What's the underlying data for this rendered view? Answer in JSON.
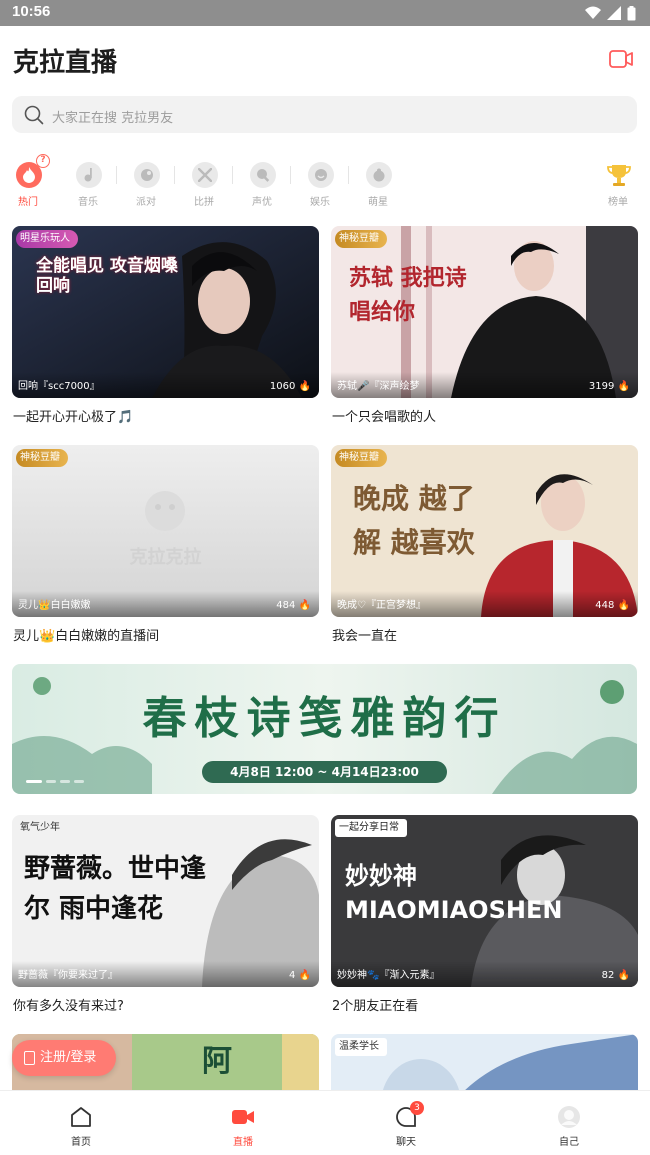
{
  "status_bar": {
    "time": "10:56"
  },
  "header": {
    "title": "克拉直播",
    "camera_icon": "video-camera-icon"
  },
  "search": {
    "placeholder": "大家正在搜 克拉男友"
  },
  "categories": [
    {
      "label": "热门",
      "icon": "flame-icon",
      "active": true,
      "badge": "?"
    },
    {
      "label": "音乐",
      "icon": "music-icon"
    },
    {
      "label": "派对",
      "icon": "party-icon"
    },
    {
      "label": "比拼",
      "icon": "pk-icon"
    },
    {
      "label": "声优",
      "icon": "voice-actor-icon"
    },
    {
      "label": "娱乐",
      "icon": "entertainment-icon"
    },
    {
      "label": "萌星",
      "icon": "cute-star-icon"
    },
    {
      "label": "榜单",
      "icon": "trophy-icon"
    }
  ],
  "cards": [
    {
      "tag": "明星乐玩人",
      "cover_text": "全能唱见 攻音烟嗓 回响",
      "host": "回响『scc7000』",
      "count": "1060",
      "caption": "一起开心开心极了🎵"
    },
    {
      "tag": "神秘豆瓣",
      "cover_text": "苏轼 我把诗唱给你",
      "host": "苏轼🎤『深声绘梦",
      "count": "3199",
      "caption": "一个只会唱歌的人"
    },
    {
      "tag": "神秘豆瓣",
      "cover_text": "克拉克拉",
      "host": "灵儿👑白白嫩嫩",
      "count": "484",
      "caption": "灵儿👑白白嫩嫩的直播间"
    },
    {
      "tag": "神秘豆瓣",
      "cover_text": "晚成 越了解 越喜欢",
      "host": "晚成♡『正宫梦想』",
      "count": "448",
      "caption": "我会一直在"
    },
    {
      "tag": "氧气少年",
      "cover_text": "野蔷薇。世中逢尔 雨中逢花",
      "host": "野蔷薇『你要来过了』",
      "count": "4",
      "caption": "你有多久没有来过?"
    },
    {
      "tag": "一起分享日常",
      "cover_text": "妙妙神 MIAOMIAOSHEN",
      "host": "妙妙神🐾『渐入元素』",
      "count": "82",
      "caption": "2个朋友正在看"
    },
    {
      "tag": "",
      "cover_text": "阿",
      "host": "",
      "count": "",
      "caption": ""
    },
    {
      "tag": "温柔学长",
      "cover_text": "",
      "host": "",
      "count": "",
      "caption": ""
    }
  ],
  "banner": {
    "title": "春枝诗笺雅韵行",
    "date": "4月8日 12:00 ~ 4月14日23:00"
  },
  "login_button": {
    "label": "注册/登录"
  },
  "bottom_nav": [
    {
      "label": "首页",
      "icon": "home-icon"
    },
    {
      "label": "直播",
      "icon": "live-camera-icon",
      "active": true
    },
    {
      "label": "聊天",
      "icon": "chat-icon",
      "badge": "3"
    },
    {
      "label": "自己",
      "icon": "avatar-icon"
    }
  ],
  "colors": {
    "accent": "#ff4b3e",
    "login": "#ff7b73",
    "banner_green": "#1f6e48"
  }
}
